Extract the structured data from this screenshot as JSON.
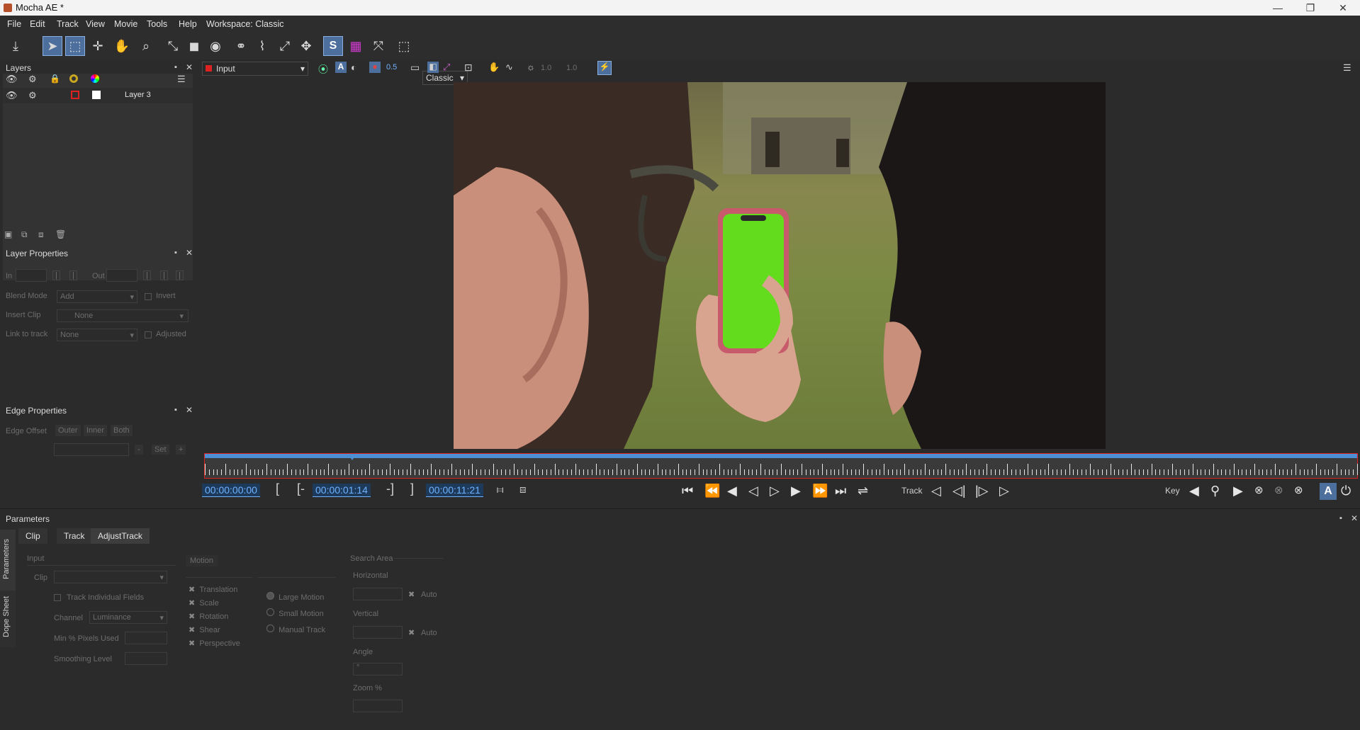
{
  "window": {
    "title": "Mocha AE *",
    "minimize": "—",
    "maximize": "❐",
    "close": "✕"
  },
  "menu": [
    "File",
    "Edit",
    "Track",
    "View",
    "Movie",
    "Tools",
    "Help"
  ],
  "workspace_label": "Workspace: Classic",
  "toolbar": {
    "layout_combo": "Classic",
    "view_combo": "Input",
    "opacity1": "0.5",
    "value_a": "1.0",
    "value_b": "1.0"
  },
  "layers": {
    "title": "Layers",
    "items": [
      {
        "name": "Layer 3"
      }
    ]
  },
  "layer_properties": {
    "title": "Layer Properties",
    "in_label": "In",
    "out_label": "Out",
    "blend_mode_label": "Blend Mode",
    "blend_mode_value": "Add",
    "invert_label": "Invert",
    "insert_clip_label": "Insert Clip",
    "insert_clip_value": "None",
    "link_to_track_label": "Link to track",
    "link_to_track_value": "None",
    "adjusted_label": "Adjusted"
  },
  "edge_properties": {
    "title": "Edge Properties",
    "edge_offset_label": "Edge Offset",
    "outer": "Outer",
    "inner": "Inner",
    "both": "Both",
    "set": "Set"
  },
  "timeline": {
    "start": "00:00:00:00",
    "in_point": "00:00:01:14",
    "end": "00:00:11:21",
    "progress": 0.128,
    "track_label": "Track",
    "key_label": "Key"
  },
  "parameters": {
    "title": "Parameters",
    "side_tabs": [
      "Parameters",
      "Dope Sheet"
    ],
    "tabs": [
      "Clip",
      "Track",
      "AdjustTrack"
    ],
    "input_section": "Input",
    "clip_label": "Clip",
    "track_individual_fields": "Track Individual Fields",
    "channel_label": "Channel",
    "channel_value": "Luminance",
    "min_pixels_label": "Min % Pixels Used",
    "smoothing_label": "Smoothing Level",
    "motion_label": "Motion",
    "motion_options": [
      "Translation",
      "Scale",
      "Rotation",
      "Shear",
      "Perspective"
    ],
    "motion_modes": [
      "Large Motion",
      "Small Motion",
      "Manual Track"
    ],
    "search_area_label": "Search Area",
    "horizontal_label": "Horizontal",
    "vertical_label": "Vertical",
    "auto_label": "Auto",
    "angle_label": "Angle",
    "angle_value": "°",
    "zoom_label": "Zoom %"
  }
}
